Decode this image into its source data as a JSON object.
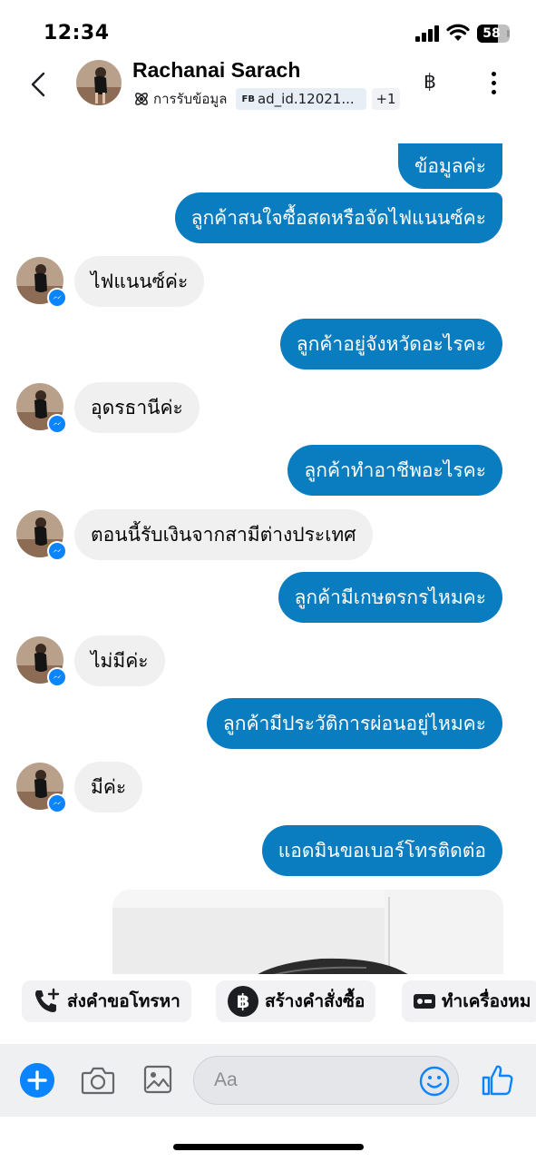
{
  "status_bar": {
    "time": "12:34",
    "battery": "58"
  },
  "header": {
    "contact_name": "Rachanai Sarach",
    "leads_label": "การรับข้อมูล",
    "ad_prefix": "FB",
    "ad_tag": "ad_id.12021...",
    "extra_tags": "+1",
    "currency_icon": "฿"
  },
  "messages": [
    {
      "direction": "out",
      "text": "ข้อมูลค่ะ"
    },
    {
      "direction": "out",
      "text": "ลูกค้าสนใจซื้อสดหรือจัดไฟแนนซ์คะ"
    },
    {
      "direction": "in",
      "text": "ไฟแนนซ์ค่ะ"
    },
    {
      "direction": "out",
      "text": "ลูกค้าอยู่จังหวัดอะไรคะ"
    },
    {
      "direction": "in",
      "text": "อุดรธานีค่ะ"
    },
    {
      "direction": "out",
      "text": "ลูกค้าทำอาชีพอะไรคะ"
    },
    {
      "direction": "in",
      "text": "ตอนนี้รับเงินจากสามีต่างประเทศ"
    },
    {
      "direction": "out",
      "text": "ลูกค้ามีเกษตรกรไหมคะ"
    },
    {
      "direction": "in",
      "text": "ไม่มีค่ะ"
    },
    {
      "direction": "out",
      "text": "ลูกค้ามีประวัติการผ่อนอยู่ไหมคะ"
    },
    {
      "direction": "in",
      "text": "มีค่ะ"
    },
    {
      "direction": "out",
      "text": "แอดมินขอเบอร์โทรติดต่อ"
    }
  ],
  "quick_actions": {
    "call_request": "ส่งคำขอโทรหา",
    "create_order": "สร้างคำสั่งซื้อ",
    "mark": "ทำเครื่องหม"
  },
  "composer": {
    "placeholder": "Aa"
  },
  "colors": {
    "outgoing_bubble": "#0a7cc0",
    "incoming_bubble": "#f0f0f0",
    "accent": "#0a84ff"
  }
}
